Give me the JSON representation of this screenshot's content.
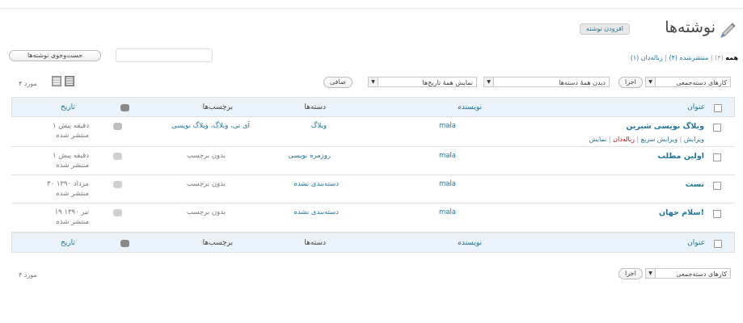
{
  "page": {
    "title": "نوشته‌ها",
    "add_new": "افزودن نوشته"
  },
  "filters": {
    "all": "همه",
    "all_count": "(۴)",
    "published": "منتشرشده (۴)",
    "trash": "زباله‌دان (۱)",
    "separator": "|"
  },
  "search": {
    "button": "جست‌وجوی نوشته‌ها",
    "value": ""
  },
  "toolbar": {
    "bulk_actions": "کارهای دسته‌جمعی",
    "apply": "اجرا",
    "dates": "نمایش همهٔ تاریخ‌ها",
    "categories": "دیدن همهٔ دسته‌ها",
    "filter": "صافی",
    "items_count": "۴ مورد"
  },
  "columns": {
    "title": "عنوان",
    "author": "نویسنده",
    "categories": "دسته‌ها",
    "tags": "برچسب‌ها",
    "date": "تاریخ"
  },
  "row_actions": {
    "edit": "ویرایش",
    "quick_edit": "ویرایش سریع",
    "trash": "زباله‌دان",
    "view": "نمایش"
  },
  "posts": [
    {
      "title": "وبلاگ نویسی شیرین",
      "author": "mala",
      "category": "وبلاگ",
      "tags": "آی تی، وبلاگ، وبلاگ نویسی",
      "date_line1": "۱ دقیقه پیش",
      "date_line2": "منتشر شده"
    },
    {
      "title": "اولین مطلب",
      "author": "mala",
      "category": "روزمره نویسی",
      "tags": "بدون برچسب",
      "date_line1": "۱ دقیقه پیش",
      "date_line2": "منتشر شده"
    },
    {
      "title": "تست",
      "author": "mala",
      "category": "دسته‌بندی نشده",
      "tags": "بدون برچسب",
      "date_line1": "۳۰ مرداد ۱۳۹۰",
      "date_line2": "منتشر شده"
    },
    {
      "title": "سلام جهان!",
      "author": "mala",
      "category": "دسته‌بندی نشده",
      "tags": "بدون برچسب",
      "date_line1": "۱۹ تیر ۱۳۹۰",
      "date_line2": "منتشر شده"
    }
  ]
}
